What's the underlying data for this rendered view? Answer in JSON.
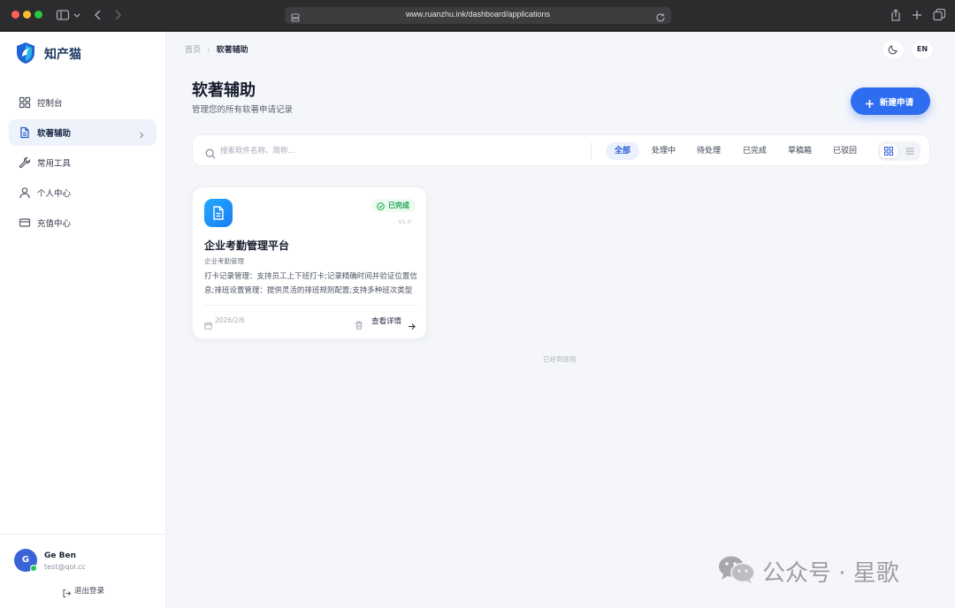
{
  "browser": {
    "url": "www.ruanzhu.ink/dashboard/applications"
  },
  "sidebar": {
    "brand": "知产猫",
    "items": [
      {
        "label": "控制台",
        "icon": "grid-icon"
      },
      {
        "label": "软著辅助",
        "icon": "document-icon",
        "active": true
      },
      {
        "label": "常用工具",
        "icon": "wrench-icon"
      },
      {
        "label": "个人中心",
        "icon": "user-icon"
      },
      {
        "label": "充值中心",
        "icon": "card-icon"
      }
    ],
    "user": {
      "initial": "G",
      "name": "Ge Ben",
      "email": "test@qol.cc"
    },
    "logout_label": "退出登录"
  },
  "topbar": {
    "breadcrumb_home": "首页",
    "breadcrumb_current": "软著辅助",
    "lang_label": "EN"
  },
  "header": {
    "title": "软著辅助",
    "subtitle": "管理您的所有软著申请记录",
    "new_button": "新建申请"
  },
  "filter": {
    "search_placeholder": "搜索软件名称、简称...",
    "tabs": [
      "全部",
      "处理中",
      "待处理",
      "已完成",
      "草稿箱",
      "已驳回"
    ],
    "active_tab": 0
  },
  "cards": [
    {
      "status": "已完成",
      "version": "V1.0",
      "title": "企业考勤管理平台",
      "short_name": "企业考勤管理",
      "description": "打卡记录管理：支持员工上下班打卡;记录精确时间并验证位置信息;排班设置管理：提供灵活的排班规则配置;支持多种班次类型",
      "date": "2026/2/6",
      "detail_label": "查看详情"
    }
  ],
  "end_text": "已经到底啦",
  "watermark": {
    "text": "公众号 · 星歌"
  },
  "colors": {
    "accent": "#2f6df0",
    "success": "#16a34a",
    "sidebar_active_bg": "#eef3fb"
  }
}
